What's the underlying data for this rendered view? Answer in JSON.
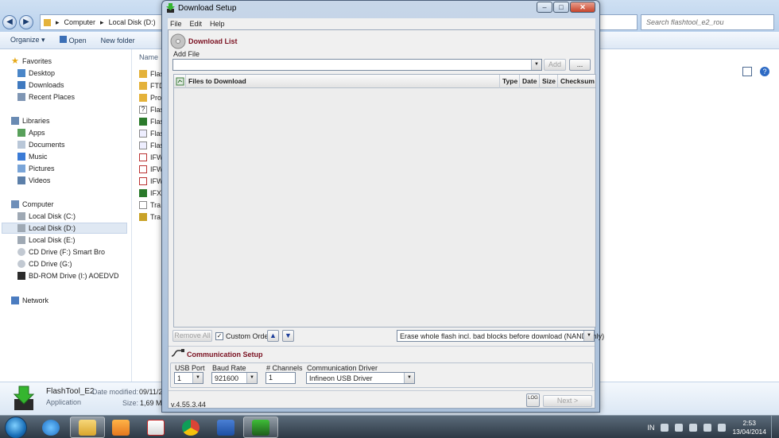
{
  "explorer": {
    "address": [
      "Computer",
      "Local Disk (D:)"
    ],
    "search_placeholder": "Search flashtool_e2_rou",
    "toolbar": {
      "organize": "Organize",
      "open": "Open",
      "new_folder": "New folder"
    },
    "column_name": "Name",
    "nav": {
      "favorites": "Favorites",
      "desktop": "Desktop",
      "downloads": "Downloads",
      "recent": "Recent Places",
      "libraries": "Libraries",
      "apps": "Apps",
      "documents": "Documents",
      "music": "Music",
      "pictures": "Pictures",
      "videos": "Videos",
      "computer": "Computer",
      "disk_c": "Local Disk (C:)",
      "disk_d": "Local Disk (D:)",
      "disk_e": "Local Disk (E:)",
      "cd_f": "CD Drive (F:) Smart Bro",
      "cd_g": "CD Drive (G:)",
      "bd_i": "BD-ROM Drive (I:) AOEDVD",
      "network": "Network"
    },
    "files": [
      "Flas",
      "FTD",
      "Pro",
      "Flas",
      "Flas",
      "Flas",
      "Flas",
      "IFW",
      "IFW",
      "IFW",
      "IFX",
      "Tra",
      "Tra"
    ],
    "details": {
      "name": "FlashTool_E2",
      "modified_label": "Date modified:",
      "modified_value": "09/11/2",
      "type": "Application",
      "size_label": "Size:",
      "size_value": "1,69 M"
    }
  },
  "window": {
    "title": "Download Setup",
    "menu": {
      "file": "File",
      "edit": "Edit",
      "help": "Help"
    },
    "download_list": {
      "title": "Download List",
      "add_file_label": "Add File",
      "add_button": "Add",
      "browse_button": "...",
      "columns": {
        "files": "Files to Download",
        "type": "Type",
        "date": "Date",
        "size": "Size",
        "checksum": "Checksum"
      },
      "remove_all": "Remove All",
      "custom_order": "Custom Order",
      "erase_option": "Erase whole flash incl. bad blocks before download (NAND only)"
    },
    "communication": {
      "title": "Communication Setup",
      "usb_port_label": "USB Port",
      "usb_port_value": "1",
      "baud_rate_label": "Baud Rate",
      "baud_rate_value": "921600",
      "channels_label": "# Channels",
      "channels_value": "1",
      "driver_label": "Communication Driver",
      "driver_value": "Infineon USB Driver"
    },
    "version": "v.4.55.3.44",
    "log_button": "LOG",
    "next_button": "Next >"
  },
  "taskbar": {
    "language": "IN",
    "time": "2:53",
    "date": "13/04/2014"
  }
}
